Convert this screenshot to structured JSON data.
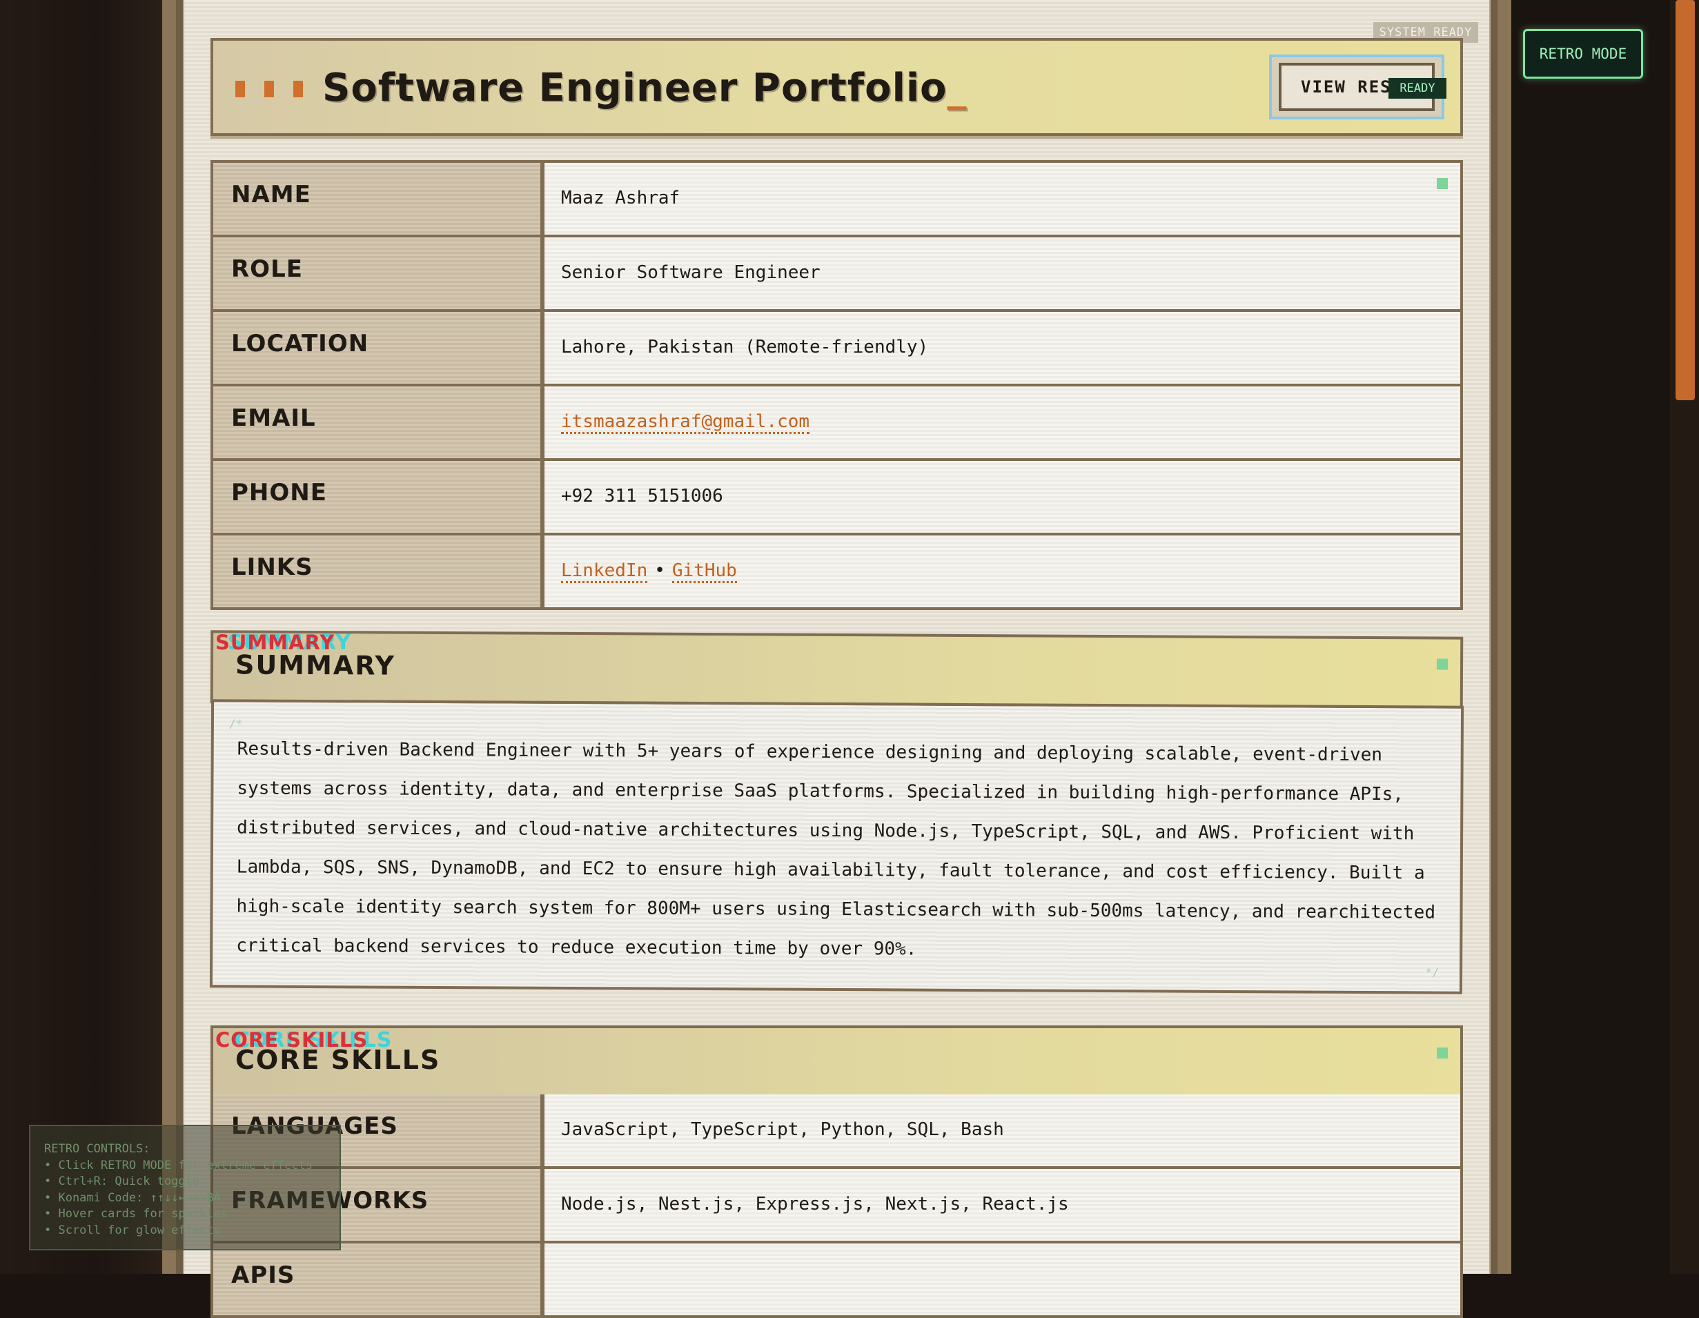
{
  "system_status": "SYSTEM READY",
  "retro_mode_button": "RETRO MODE",
  "header": {
    "title": "Software Engineer Portfolio",
    "cursor": "_",
    "view_button_label": "VIEW RESUME",
    "view_button_badge": "READY"
  },
  "profile": [
    {
      "label": "NAME",
      "value": "Maaz Ashraf"
    },
    {
      "label": "ROLE",
      "value": "Senior Software Engineer"
    },
    {
      "label": "LOCATION",
      "value": "Lahore, Pakistan (Remote-friendly)"
    },
    {
      "label": "EMAIL",
      "value": "itsmaazashraf@gmail.com"
    },
    {
      "label": "PHONE",
      "value": "+92 311 5151006"
    },
    {
      "label": "LINKS",
      "links": [
        "LinkedIn",
        "GitHub"
      ],
      "separator": "•"
    }
  ],
  "summary": {
    "title": "SUMMARY",
    "comment_open": "/*",
    "comment_close": "*/",
    "text": "Results-driven Backend Engineer with 5+ years of experience designing and deploying scalable, event-driven systems across identity, data, and enterprise SaaS platforms. Specialized in building high-performance APIs, distributed services, and cloud-native architectures using Node.js, TypeScript, SQL, and AWS. Proficient with Lambda, SQS, SNS, DynamoDB, and EC2 to ensure high availability, fault tolerance, and cost efficiency. Built a high-scale identity search system for 800M+ users using Elasticsearch with sub-500ms latency, and rearchitected critical backend services to reduce execution time by over 90%."
  },
  "core_skills": {
    "title": "CORE SKILLS",
    "rows": [
      {
        "label": "LANGUAGES",
        "value": "JavaScript, TypeScript, Python, SQL, Bash"
      },
      {
        "label": "FRAMEWORKS",
        "value": "Node.js, Nest.js, Express.js, Next.js, React.js"
      },
      {
        "label": "APIS",
        "value": ""
      }
    ]
  },
  "retro_controls": {
    "title": "RETRO CONTROLS:",
    "items": [
      "• Click RETRO MODE for extreme effects",
      "• Ctrl+R: Quick toggle",
      "• Konami Code: ↑↑↓↓←→←→BA",
      "• Hover cards for sparkles",
      "• Scroll for glow effects"
    ]
  },
  "colors": {
    "accent": "#c2611f",
    "frame": "#7f6c52",
    "header_bg": "#e8df9c",
    "status_green": "#7fd49a"
  }
}
